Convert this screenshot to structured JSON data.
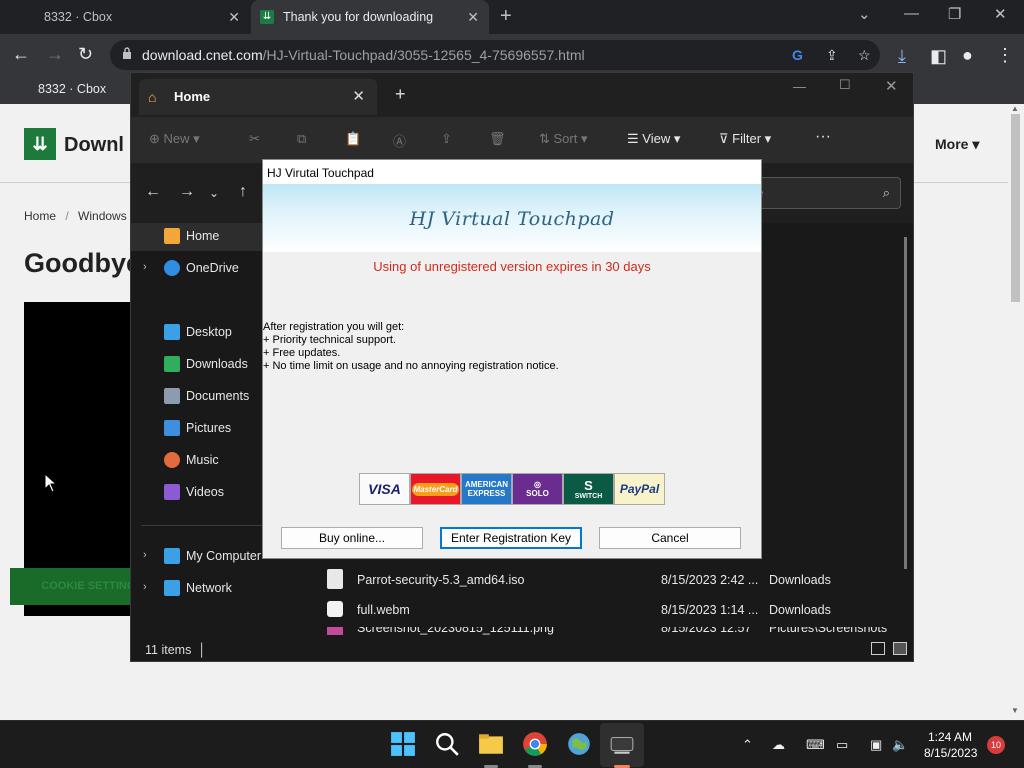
{
  "browser": {
    "tabs": [
      {
        "title": "8332 · Cbox"
      },
      {
        "title": "Thank you for downloading HJ V"
      }
    ],
    "url_domain": "download.cnet.com",
    "url_path": "/HJ-Virtual-Touchpad/3055-12565_4-75696557.html",
    "bookmark": "8332 · Cbox"
  },
  "webpage": {
    "logo_text": "Downl",
    "more_label": "More",
    "breadcrumb_home": "Home",
    "breadcrumb_sep": "/",
    "breadcrumb_windows": "Windows",
    "heading": "Goodbye",
    "cookie_button": "COOKIE SETTINGS"
  },
  "explorer": {
    "tab_title": "Home",
    "commands": {
      "new": "New",
      "sort": "Sort",
      "view": "View",
      "filter": "Filter"
    },
    "search_placeholder": "me",
    "sidebar": [
      {
        "label": "Home",
        "icon": "home-icon",
        "color": "#f4a63a"
      },
      {
        "label": "OneDrive",
        "icon": "cloud-icon",
        "color": "#2f8ee3"
      },
      {
        "label": "Desktop",
        "icon": "desktop-icon",
        "color": "#3aa0e8"
      },
      {
        "label": "Downloads",
        "icon": "download-icon",
        "color": "#2fae5b"
      },
      {
        "label": "Documents",
        "icon": "document-icon",
        "color": "#8a9cb0"
      },
      {
        "label": "Pictures",
        "icon": "picture-icon",
        "color": "#3d8fe0"
      },
      {
        "label": "Music",
        "icon": "music-icon",
        "color": "#e26a3c"
      },
      {
        "label": "Videos",
        "icon": "video-icon",
        "color": "#8b5bd6"
      },
      {
        "label": "My Computer",
        "icon": "computer-icon",
        "color": "#3aa0e8"
      },
      {
        "label": "Network",
        "icon": "network-icon",
        "color": "#3aa0e8"
      }
    ],
    "files": [
      {
        "name": "Parrot-security-5.3_amd64.iso",
        "date": "8/15/2023 2:42 ...",
        "location": "Downloads"
      },
      {
        "name": "full.webm",
        "date": "8/15/2023 1:14 ...",
        "location": "Downloads"
      },
      {
        "name": "Screenshot_20230815_125111.png",
        "date": "8/15/2023 12:57",
        "location": "Pictures\\Screenshots"
      }
    ],
    "status_count": "11 items"
  },
  "dialog": {
    "title": "HJ Virutal Touchpad",
    "banner_title": "HJ Virtual Touchpad",
    "expiry_notice": "Using of unregistered version expires in 30 days",
    "benefits_header": "After registration you will get:",
    "benefits": [
      "+ Priority technical support.",
      "+ Free updates.",
      "+ No time limit on usage and no annoying registration notice."
    ],
    "payment_methods": {
      "visa": "VISA",
      "mastercard": "MasterCard",
      "amex_line1": "AMERICAN",
      "amex_line2": "EXPRESS",
      "solo": "SOLO",
      "switch": "SWITCH",
      "paypal": "PayPal"
    },
    "buttons": {
      "buy": "Buy online...",
      "register": "Enter Registration Key",
      "cancel": "Cancel"
    }
  },
  "taskbar": {
    "time": "1:24 AM",
    "date": "8/15/2023",
    "notification_count": "10"
  }
}
